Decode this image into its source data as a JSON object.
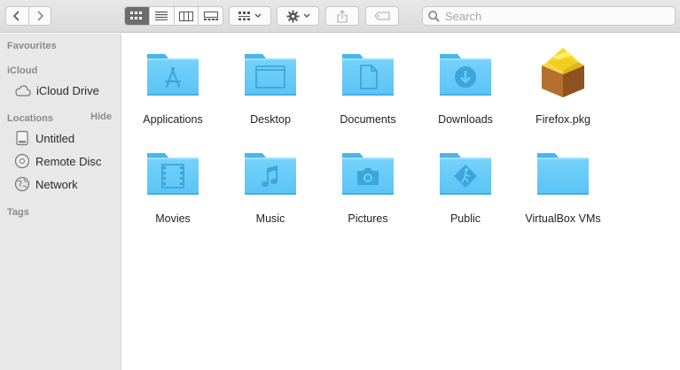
{
  "toolbar": {
    "search_placeholder": "Search",
    "view_modes": [
      "icon-view",
      "list-view",
      "column-view",
      "gallery-view"
    ],
    "active_view": "icon-view"
  },
  "sidebar": {
    "favourites_header": "Favourites",
    "icloud_header": "iCloud",
    "icloud_drive": "iCloud Drive",
    "locations_header": "Locations",
    "hide_label": "Hide",
    "locations": [
      {
        "label": "Untitled",
        "icon": "drive-icon"
      },
      {
        "label": "Remote Disc",
        "icon": "disc-icon"
      },
      {
        "label": "Network",
        "icon": "network-icon"
      }
    ],
    "tags_header": "Tags"
  },
  "items": [
    {
      "label": "Applications",
      "icon": "applications-folder-icon"
    },
    {
      "label": "Desktop",
      "icon": "desktop-folder-icon"
    },
    {
      "label": "Documents",
      "icon": "documents-folder-icon"
    },
    {
      "label": "Downloads",
      "icon": "downloads-folder-icon"
    },
    {
      "label": "Firefox.pkg",
      "icon": "package-icon"
    },
    {
      "label": "Movies",
      "icon": "movies-folder-icon"
    },
    {
      "label": "Music",
      "icon": "music-folder-icon"
    },
    {
      "label": "Pictures",
      "icon": "pictures-folder-icon"
    },
    {
      "label": "Public",
      "icon": "public-folder-icon"
    },
    {
      "label": "VirtualBox VMs",
      "icon": "folder-icon"
    }
  ],
  "colors": {
    "folder_light": "#6ccdf8",
    "folder_dark": "#3fb1ec",
    "folder_glyph": "#39a6dc",
    "active_segment": "#6e6d6d"
  }
}
